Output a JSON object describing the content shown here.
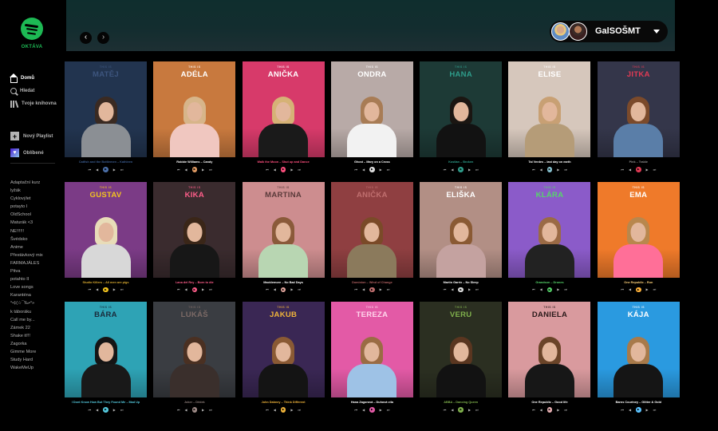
{
  "app": {
    "logo_text": "OKTÁVA"
  },
  "sidebar": {
    "nav": [
      {
        "label": "Domů",
        "icon": "home-icon",
        "active": true
      },
      {
        "label": "Hledat",
        "icon": "search-icon",
        "active": false
      },
      {
        "label": "Tvoje knihovna",
        "icon": "library-icon",
        "active": false
      }
    ],
    "actions": [
      {
        "label": "Nový Playlist",
        "icon": "plus-icon",
        "glyph": "+"
      },
      {
        "label": "Oblíbené",
        "icon": "heart-icon",
        "glyph": "♥"
      }
    ],
    "playlists": [
      "Adaptační kurz",
      "lyžák",
      "Cyklovýlet",
      "potayto I",
      "OldSchool",
      "Maturák <3",
      "NE!!!!!!",
      "Švédsko",
      "Anime",
      "Přestávkový mix",
      "FARMAJÁLES",
      "Pitva",
      "potahto II",
      "Love songs",
      "Karanténa",
      "°•‡(☆¯‰•°»",
      "k táboráku",
      "Call me by...",
      "Zámek 22",
      "Shake it!!!",
      "Zagorka",
      "Gimme More",
      "Study Hard",
      "WakeMeUp"
    ]
  },
  "header": {
    "back_glyph": "‹",
    "forward_glyph": "›",
    "user_name": "GalSOŠMT",
    "background": "#132d2f"
  },
  "cards": [
    {
      "this_is": "THIS IS",
      "name": "MATĚJ",
      "song": "Catfish and the Bottlemen – Kathleen",
      "bg": "#22344f",
      "name_color": "#3d557e",
      "song_color": "#3a5a8c",
      "accent": "#4b6fa8",
      "hair": "#3a2a22",
      "body": "#8b8f94"
    },
    {
      "this_is": "THIS IS",
      "name": "ADÉLA",
      "song": "Robbie Williams – Candy",
      "bg": "#c8793e",
      "name_color": "#ffffff",
      "song_color": "#ffffff",
      "accent": "#e09a63",
      "hair": "#d7b58a",
      "body": "#f0c7c0"
    },
    {
      "this_is": "THIS IS",
      "name": "ANIČKA",
      "song": "Walk the Moon – Shut up and Dance",
      "bg": "#d73a6a",
      "name_color": "#ffffff",
      "song_color": "#ff4f7e",
      "accent": "#ff4f7e",
      "hair": "#d6b276",
      "body": "#1a1a1a"
    },
    {
      "this_is": "THIS IS",
      "name": "ONDRA",
      "song": "Ghost – Mary on a Cross",
      "bg": "#b8aaa7",
      "name_color": "#ffffff",
      "song_color": "#ffffff",
      "accent": "#dddddd",
      "hair": "#a87c55",
      "body": "#f2f2f2"
    },
    {
      "this_is": "THIS IS",
      "name": "HANA",
      "song": "Kostlan – Broken",
      "bg": "#1d3a36",
      "name_color": "#2e9c8a",
      "song_color": "#2e9c8a",
      "accent": "#2e9c8a",
      "hair": "#1b1612",
      "body": "#121212"
    },
    {
      "this_is": "THIS IS",
      "name": "ELISE",
      "song": "Tai Verdes – last day on earth",
      "bg": "#d6c7bc",
      "name_color": "#ffffff",
      "song_color": "#ffffff",
      "accent": "#87c2d0",
      "hair": "#c8a074",
      "body": "#b59c78"
    },
    {
      "this_is": "THIS IS",
      "name": "JITKA",
      "song": "Pink – Trable",
      "bg": "#34364a",
      "name_color": "#e13a54",
      "song_color": "#8b8b8b",
      "accent": "#e13a54",
      "hair": "#7b4a2b",
      "body": "#5a7ea8"
    },
    {
      "this_is": "THIS IS",
      "name": "GUSTAV",
      "song": "Studio Killers – All men are pigs",
      "bg": "#7b3b86",
      "name_color": "#f3c41f",
      "song_color": "#d8a92f",
      "accent": "#f3c41f",
      "hair": "#e8dcb8",
      "body": "#d8d8d8"
    },
    {
      "this_is": "THIS IS",
      "name": "KIKA",
      "song": "Lana del Rey – Born to die",
      "bg": "#3a2b2e",
      "name_color": "#ff5e8a",
      "song_color": "#ff5e8a",
      "accent": "#ff5e8a",
      "hair": "#3a2618",
      "body": "#171717"
    },
    {
      "this_is": "THIS IS",
      "name": "MARTINA",
      "song": "Macklemore – No Bad Days",
      "bg": "#cd8d8f",
      "name_color": "#5a3a3a",
      "song_color": "#ffffff",
      "accent": "#e7a9a0",
      "hair": "#8a5a3a",
      "body": "#b8d6b2"
    },
    {
      "this_is": "THIS IS",
      "name": "ANIČKA",
      "song": "Dominion – Wind of Change",
      "bg": "#8f3f41",
      "name_color": "#c06f6f",
      "song_color": "#b06060",
      "accent": "#c06f6f",
      "hair": "#7a4a28",
      "body": "#8b7a5c"
    },
    {
      "this_is": "THIS IS",
      "name": "ELIŠKA",
      "song": "Martin Garrix – No Sleep",
      "bg": "#b28f85",
      "name_color": "#ffffff",
      "song_color": "#ffffff",
      "accent": "#dddddd",
      "hair": "#8a5a34",
      "body": "#c4a2a0"
    },
    {
      "this_is": "THIS IS",
      "name": "KLÁRA",
      "song": "Grandson – Drones",
      "bg": "#8b5bc9",
      "name_color": "#56d56a",
      "song_color": "#56d56a",
      "accent": "#56d56a",
      "hair": "#9a6a45",
      "body": "#222222"
    },
    {
      "this_is": "THIS IS",
      "name": "EMA",
      "song": "One Republic – Run",
      "bg": "#ef7a2a",
      "name_color": "#ffffff",
      "song_color": "#ffd27a",
      "accent": "#ffb23a",
      "hair": "#b8874d",
      "body": "#ff6f98"
    },
    {
      "this_is": "THIS IS",
      "name": "BÁRA",
      "song": "I Dont Know How But They Found Me – Mad Up",
      "bg": "#2ea3b5",
      "name_color": "#1a2a3a",
      "song_color": "#54c8dc",
      "accent": "#54c8dc",
      "hair": "#151515",
      "body": "#191919"
    },
    {
      "this_is": "THIS IS",
      "name": "LUKÁŠ",
      "song": "Joker – Dědek",
      "bg": "#3a3d42",
      "name_color": "#7c6a66",
      "song_color": "#8a7a76",
      "accent": "#a08c88",
      "hair": "#4a3022",
      "body": "#3a2f2c"
    },
    {
      "this_is": "THIS IS",
      "name": "JAKUB",
      "song": "John Dabney – Think Different",
      "bg": "#3a2754",
      "name_color": "#f0b43a",
      "song_color": "#f0b43a",
      "accent": "#f0b43a",
      "hair": "#8a5a34",
      "body": "#141414"
    },
    {
      "this_is": "THIS IS",
      "name": "TEREZA",
      "song": "Hana Zagorová – Duhová víla",
      "bg": "#e35aa6",
      "name_color": "#ffd6ec",
      "song_color": "#ffffff",
      "accent": "#e35aa6",
      "hair": "#9a6c44",
      "body": "#9ec2e6"
    },
    {
      "this_is": "THIS IS",
      "name": "VERU",
      "song": "ABBA – Dancing Queen",
      "bg": "#2b2f21",
      "name_color": "#7fb04c",
      "song_color": "#7fb04c",
      "accent": "#7fb04c",
      "hair": "#5a3620",
      "body": "#121212"
    },
    {
      "this_is": "THIS IS",
      "name": "DANIELA",
      "song": "One Republic – Good life",
      "bg": "#d99a9e",
      "name_color": "#2a1a1a",
      "song_color": "#ffffff",
      "accent": "#e8b0b3",
      "hair": "#6a4428",
      "body": "#171717"
    },
    {
      "this_is": "THIS IS",
      "name": "KÁJA",
      "song": "Barns Courtney – Glitter & Gold",
      "bg": "#2a9ae0",
      "name_color": "#ffffff",
      "song_color": "#ffffff",
      "accent": "#5cc3ff",
      "hair": "#a87a4a",
      "body": "#151515"
    }
  ],
  "controls": {
    "prev": "⏮",
    "back": "◀",
    "play": "▶",
    "fwd": "▶",
    "next": "⏭"
  }
}
